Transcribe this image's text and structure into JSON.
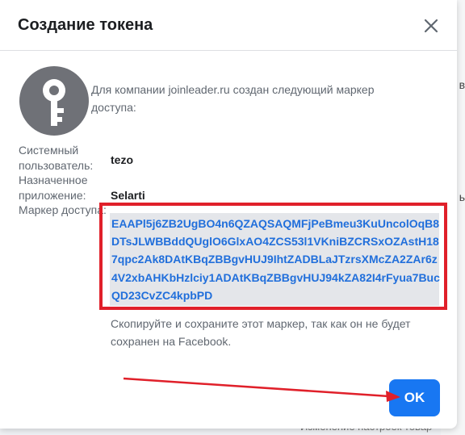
{
  "background": {
    "right_fragment_1": "в",
    "right_fragment_2": "ь",
    "bottom_text": "Изменение настроек товар"
  },
  "dialog": {
    "title": "Создание токена",
    "close_icon": "close-icon",
    "avatar_icon": "key-icon",
    "intro_text": "Для компании joinleader.ru создан следующий маркер доступа:",
    "labels": {
      "system_user": "Системный пользователь:",
      "assigned_app": "Назначенное приложение:",
      "access_token": "Маркер доступа:"
    },
    "values": {
      "system_user": "tezo",
      "assigned_app": "Selarti",
      "access_token": "EAAPl5j6ZB2UgBO4n6QZAQSAQMFjPeBmeu3KuUncolOqB8DTsJLWBBddQUglO6GlxAO4ZCS53l1VKniBZCRSxOZAstH187qpc2Ak8DAtKBqZBBgvHUJ9IhtZADBLaJTzrsXMcZA2ZAr6z4V2xbAHKbHzlciy1ADAtKBqZBBgvHUJ94kZA82I4rFyua7BucQD23CvZC4kpbPD"
    },
    "note": "Скопируйте и сохраните этот маркер, так как он не будет сохранен на Facebook.",
    "ok_label": "OK"
  },
  "colors": {
    "primary_button": "#1877f2",
    "token_text": "#216fdb",
    "highlight_annotation": "#e0202a"
  }
}
